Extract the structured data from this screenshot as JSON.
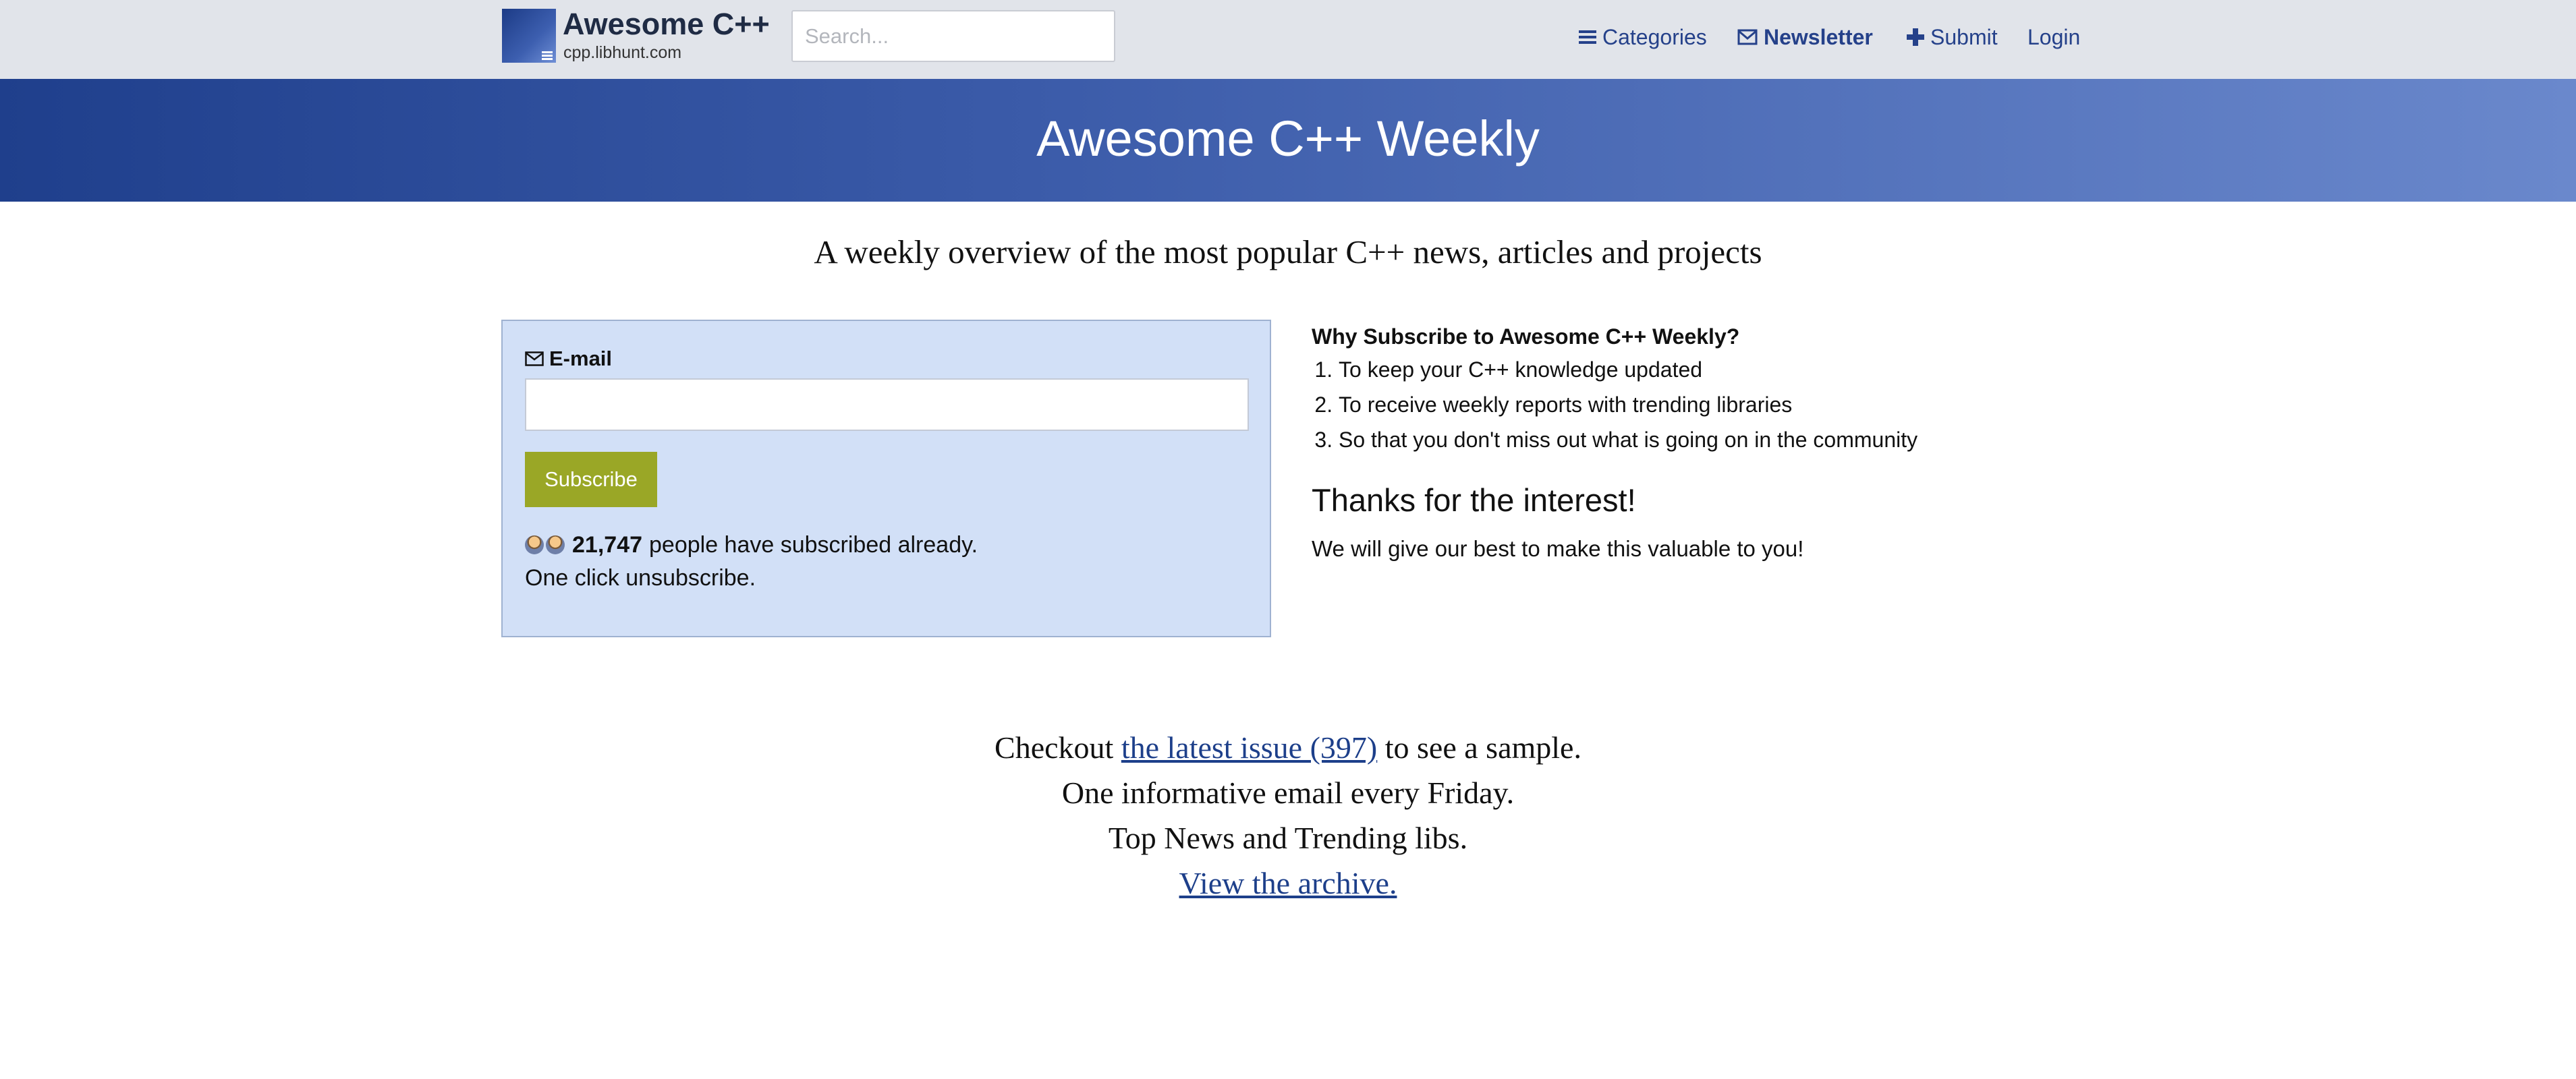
{
  "navbar": {
    "brand_title": "Awesome C++",
    "brand_subtitle": "cpp.libhunt.com",
    "search_placeholder": "Search...",
    "categories_label": "Categories",
    "newsletter_label": "Newsletter",
    "submit_label": "Submit",
    "login_label": "Login"
  },
  "hero": {
    "title": "Awesome C++ Weekly"
  },
  "tagline": "A weekly overview of the most popular C++ news, articles and projects",
  "form": {
    "email_label": "E-mail",
    "email_value": "",
    "subscribe_label": "Subscribe",
    "subscriber_count": "21,747",
    "subscriber_text": "people have subscribed already.",
    "unsubscribe_text": "One click unsubscribe."
  },
  "why": {
    "title": "Why Subscribe to Awesome C++ Weekly?",
    "reasons": [
      "To keep your C++ knowledge updated",
      "To receive weekly reports with trending libraries",
      "So that you don't miss out what is going on in the community"
    ],
    "thanks_title": "Thanks for the interest!",
    "thanks_text": "We will give our best to make this valuable to you!"
  },
  "bottom": {
    "checkout_prefix": "Checkout",
    "latest_issue_link": "the latest issue (397)",
    "checkout_suffix": "to see a sample.",
    "line2": "One informative email every Friday.",
    "line3": "Top News and Trending libs.",
    "archive_link": "View the archive."
  },
  "colors": {
    "navbar_bg": "#e1e4ea",
    "link": "#25418a",
    "hero_start": "#1f3f8c",
    "hero_end": "#6a88cc",
    "card_bg": "#d2e0f7",
    "subscribe_btn": "#9aa726"
  }
}
